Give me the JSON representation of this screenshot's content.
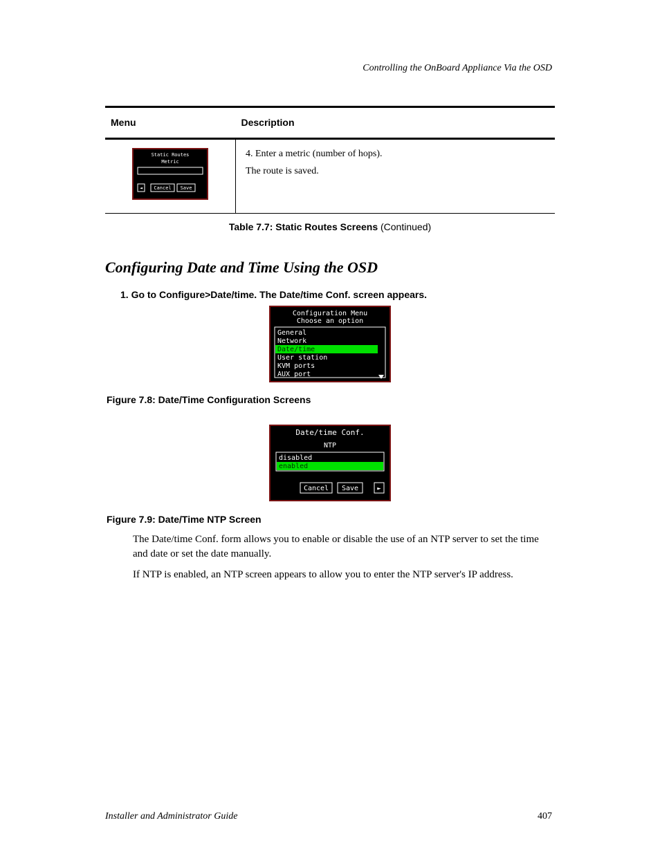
{
  "headerLine": "Controlling the OnBoard Appliance Via the OSD",
  "table": {
    "caption": {
      "prefix": "Table 7.7: Static Routes Screens",
      "suffix": "(Continued)"
    },
    "headers": [
      "Menu",
      "Description"
    ],
    "row": {
      "step": "4. Enter a metric (number of hops).",
      "saved": "The route is saved.",
      "screenshot": {
        "title": "Static Routes",
        "subtitle": "Metric",
        "backBtn": "◄",
        "cancelBtn": "Cancel",
        "saveBtn": "Save"
      }
    }
  },
  "heading": "Configuring Date and Time Using the OSD",
  "step1": "1. Go to Configure>Date/time. The Date/time Conf. screen appears.",
  "fig78": {
    "title1": "Configuration Menu",
    "title2": "Choose an option",
    "items": [
      "General",
      "Network",
      "Date/time",
      "User station",
      "KVM ports",
      "AUX port"
    ],
    "caption": "Figure 7.8: Date/Time Configuration Screens"
  },
  "fig79": {
    "title": "Date/time Conf.",
    "subtitle": "NTP",
    "items": [
      "disabled",
      "enabled"
    ],
    "cancelBtn": "Cancel",
    "saveBtn": "Save",
    "nextBtn": "►",
    "caption": "Figure 7.9: Date/Time NTP Screen"
  },
  "body1": "The Date/time Conf. form allows you to enable or disable the use of an NTP server to set the time and date or set the date manually.",
  "body2": "If NTP is enabled, an NTP screen appears to allow you to enter the NTP server's IP address.",
  "footer": {
    "label": "Installer and Administrator Guide",
    "page": "407"
  }
}
